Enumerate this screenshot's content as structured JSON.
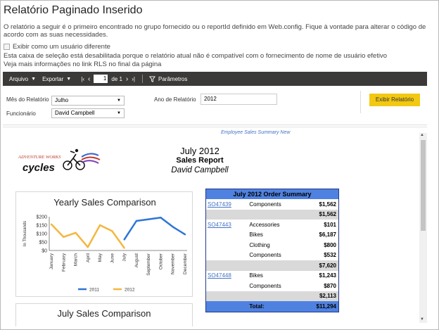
{
  "page": {
    "title": "Relatório Paginado Inserido",
    "description": "O relatório a seguir é o primeiro encontrado no grupo fornecido ou o reportId definido em Web.config. Fique à vontade para alterar o código de acordo com as suas necessidades.",
    "checkbox_label": "Exibir como um usuário diferente",
    "disabled_note": "Esta caixa de seleção está desabilitada porque o relatório atual não é compatível com o fornecimento de nome de usuário efetivo",
    "rls_note": "Veja mais informações no link RLS no final da página"
  },
  "toolbar": {
    "file_label": "Arquivo",
    "export_label": "Exportar",
    "page_current": "1",
    "page_of": "de 1",
    "params_label": "Parâmetros",
    "first_icon": "first-page-icon",
    "prev_icon": "prev-page-icon",
    "next_icon": "next-page-icon",
    "last_icon": "last-page-icon",
    "filter_icon": "filter-icon"
  },
  "params": {
    "month_label": "Mês do Relatório",
    "month_value": "Julho",
    "employee_label": "Funcionário",
    "employee_value": "David Campbell",
    "year_label": "Ano de Relatório",
    "year_value": "2012",
    "view_button": "Exibir Relatório"
  },
  "report": {
    "top_link": "Employee Sales Summary New",
    "logo_line1": "ADVENTURE WORKS",
    "logo_line2": "cycles",
    "date": "July  2012",
    "heading": "Sales Report",
    "employee": "David Campbell",
    "chart2_title": "July  Sales Comparison",
    "summary": {
      "title": "July 2012 Order Summary",
      "rows": [
        {
          "order": "SO47439",
          "product": "Components",
          "amount": "$1,562",
          "subtotal": false
        },
        {
          "order": "",
          "product": "",
          "amount": "$1,562",
          "subtotal": true
        },
        {
          "order": "SO47443",
          "product": "Accessories",
          "amount": "$101",
          "subtotal": false
        },
        {
          "order": "",
          "product": "Bikes",
          "amount": "$6,187",
          "subtotal": false
        },
        {
          "order": "",
          "product": "Clothing",
          "amount": "$800",
          "subtotal": false
        },
        {
          "order": "",
          "product": "Components",
          "amount": "$532",
          "subtotal": false
        },
        {
          "order": "",
          "product": "",
          "amount": "$7,620",
          "subtotal": true
        },
        {
          "order": "SO47448",
          "product": "Bikes",
          "amount": "$1,243",
          "subtotal": false
        },
        {
          "order": "",
          "product": "Components",
          "amount": "$870",
          "subtotal": false
        },
        {
          "order": "",
          "product": "",
          "amount": "$2,113",
          "subtotal": true
        }
      ],
      "total_label": "Total:",
      "total_value": "$11,294"
    }
  },
  "chart_data": {
    "type": "line",
    "title": "Yearly Sales Comparison",
    "ylabel": "In Thousands",
    "xlabel": "",
    "categories": [
      "January",
      "February",
      "March",
      "April",
      "May",
      "June",
      "July",
      "August",
      "September",
      "October",
      "November",
      "December"
    ],
    "ylim": [
      0,
      200
    ],
    "yticks": [
      "$0",
      "$50",
      "$100",
      "$150",
      "$200"
    ],
    "series": [
      {
        "name": "2011",
        "color": "#2e75d6",
        "values": [
          null,
          null,
          null,
          null,
          null,
          null,
          65,
          175,
          185,
          195,
          140,
          95
        ]
      },
      {
        "name": "2012",
        "color": "#f4b73e",
        "values": [
          155,
          80,
          105,
          20,
          150,
          115,
          15,
          null,
          null,
          null,
          null,
          null
        ]
      }
    ],
    "legend": "bottom",
    "grid": false
  }
}
